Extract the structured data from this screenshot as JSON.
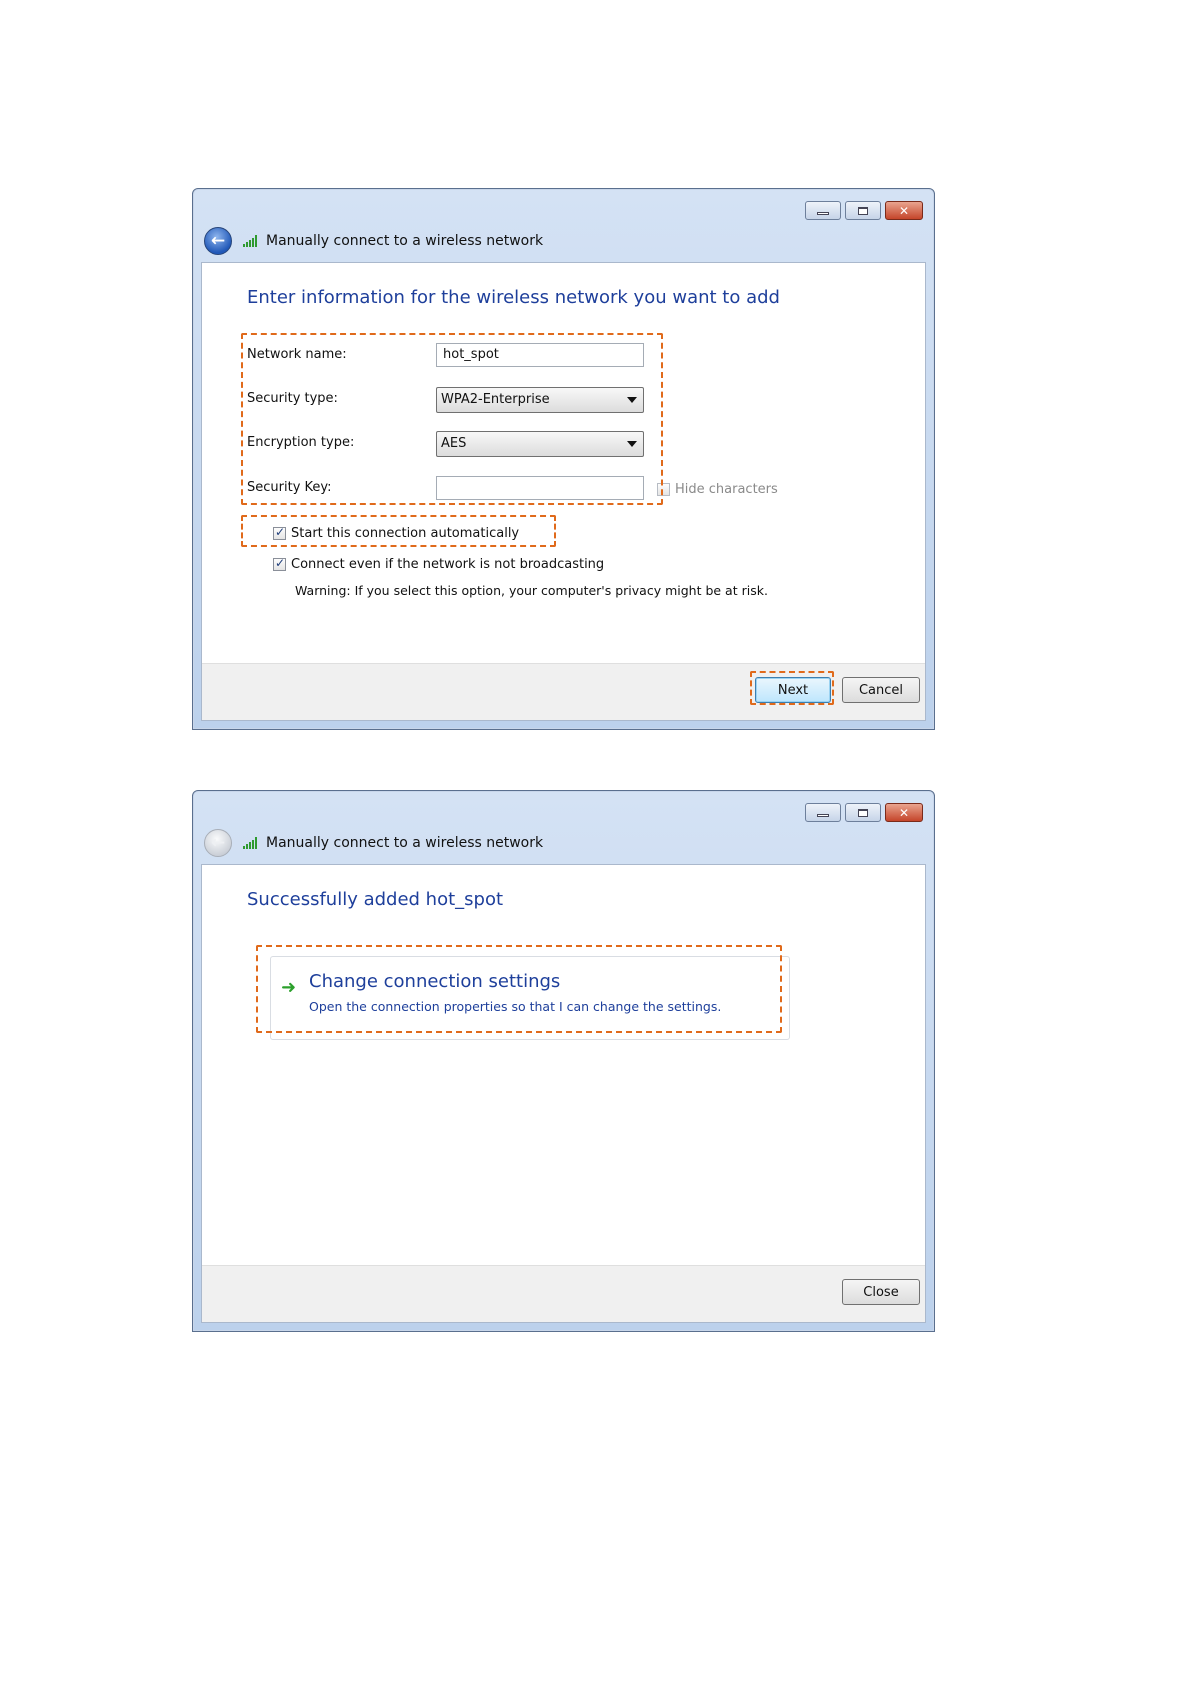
{
  "dialog1": {
    "title": "Manually connect to a wireless network",
    "heading": "Enter information for the wireless network you want to add",
    "network_name_label": "Network name:",
    "network_name_value": "hot_spot",
    "security_type_label": "Security type:",
    "security_type_value": "WPA2-Enterprise",
    "encryption_type_label": "Encryption type:",
    "encryption_type_value": "AES",
    "security_key_label": "Security Key:",
    "security_key_value": "",
    "hide_characters_label": "Hide characters",
    "start_auto_label": "Start this connection automatically",
    "connect_even_label": "Connect even if the network is not broadcasting",
    "warning_text": "Warning: If you select this option, your computer's privacy might be at risk.",
    "next_label": "Next",
    "cancel_label": "Cancel"
  },
  "dialog2": {
    "title": "Manually connect to a wireless network",
    "heading": "Successfully added hot_spot",
    "link_title": "Change connection settings",
    "link_desc": "Open the connection properties so that I can change the settings.",
    "close_label": "Close"
  },
  "colors": {
    "heading_blue": "#1e3f9b",
    "highlight_orange": "#e06a1b",
    "arrow_green": "#2ca02c"
  },
  "icons": {
    "back": "back-arrow-icon",
    "signal": "wireless-signal-icon",
    "minimize": "minimize-icon",
    "maximize": "maximize-icon",
    "close": "close-icon",
    "link_arrow": "green-arrow-icon"
  }
}
